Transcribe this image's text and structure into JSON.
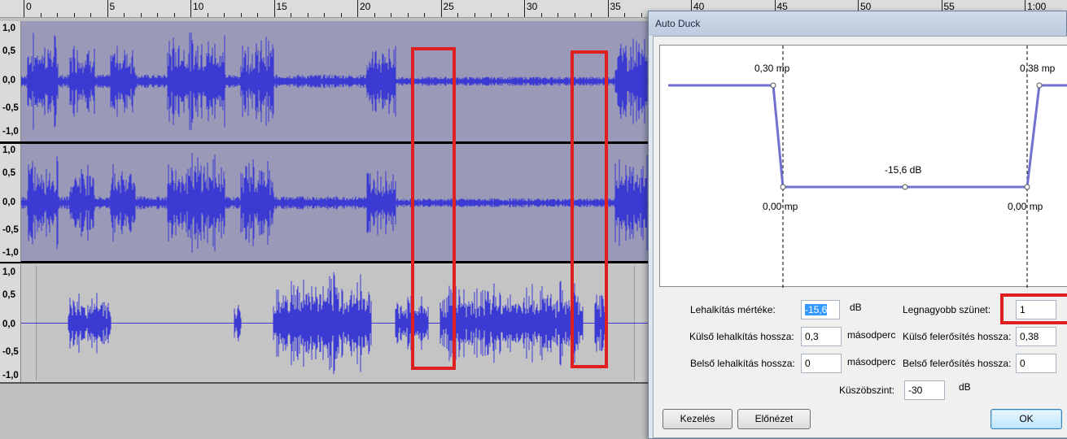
{
  "timeline": {
    "labels": [
      "0",
      "5",
      "10",
      "15",
      "20",
      "25",
      "30",
      "35",
      "40",
      "45",
      "50",
      "55",
      "1:00"
    ]
  },
  "tracks": {
    "scale_labels": [
      "1,0",
      "0,5",
      "0,0",
      "-0,5",
      "-1,0"
    ]
  },
  "dialog": {
    "title": "Auto Duck",
    "curve": {
      "outer_fade_down_label": "0,30 mp",
      "outer_fade_up_label": "0,38 mp",
      "inner_fade_down_label": "0,00 mp",
      "inner_fade_up_label": "0,00 mp",
      "duck_amount_label": "-15,6 dB"
    },
    "fields": {
      "duck_amount": {
        "label": "Lehalkítás mértéke:",
        "value": "-15,6",
        "unit": "dB"
      },
      "max_pause": {
        "label": "Legnagyobb szünet:",
        "value": "1",
        "unit": ""
      },
      "outer_fade_down": {
        "label": "Külső lehalkítás hossza:",
        "value": "0,3",
        "unit": "másodperc"
      },
      "outer_fade_up": {
        "label": "Külső felerősítés hossza:",
        "value": "0,38",
        "unit": ""
      },
      "inner_fade_down": {
        "label": "Belső lehalkítás hossza:",
        "value": "0",
        "unit": "másodperc"
      },
      "inner_fade_up": {
        "label": "Belső felerősítés hossza:",
        "value": "0",
        "unit": ""
      },
      "threshold": {
        "label": "Küszöbszint:",
        "value": "-30",
        "unit": "dB"
      }
    },
    "buttons": {
      "manage": "Kezelés",
      "preview": "Előnézet",
      "ok": "OK"
    }
  }
}
